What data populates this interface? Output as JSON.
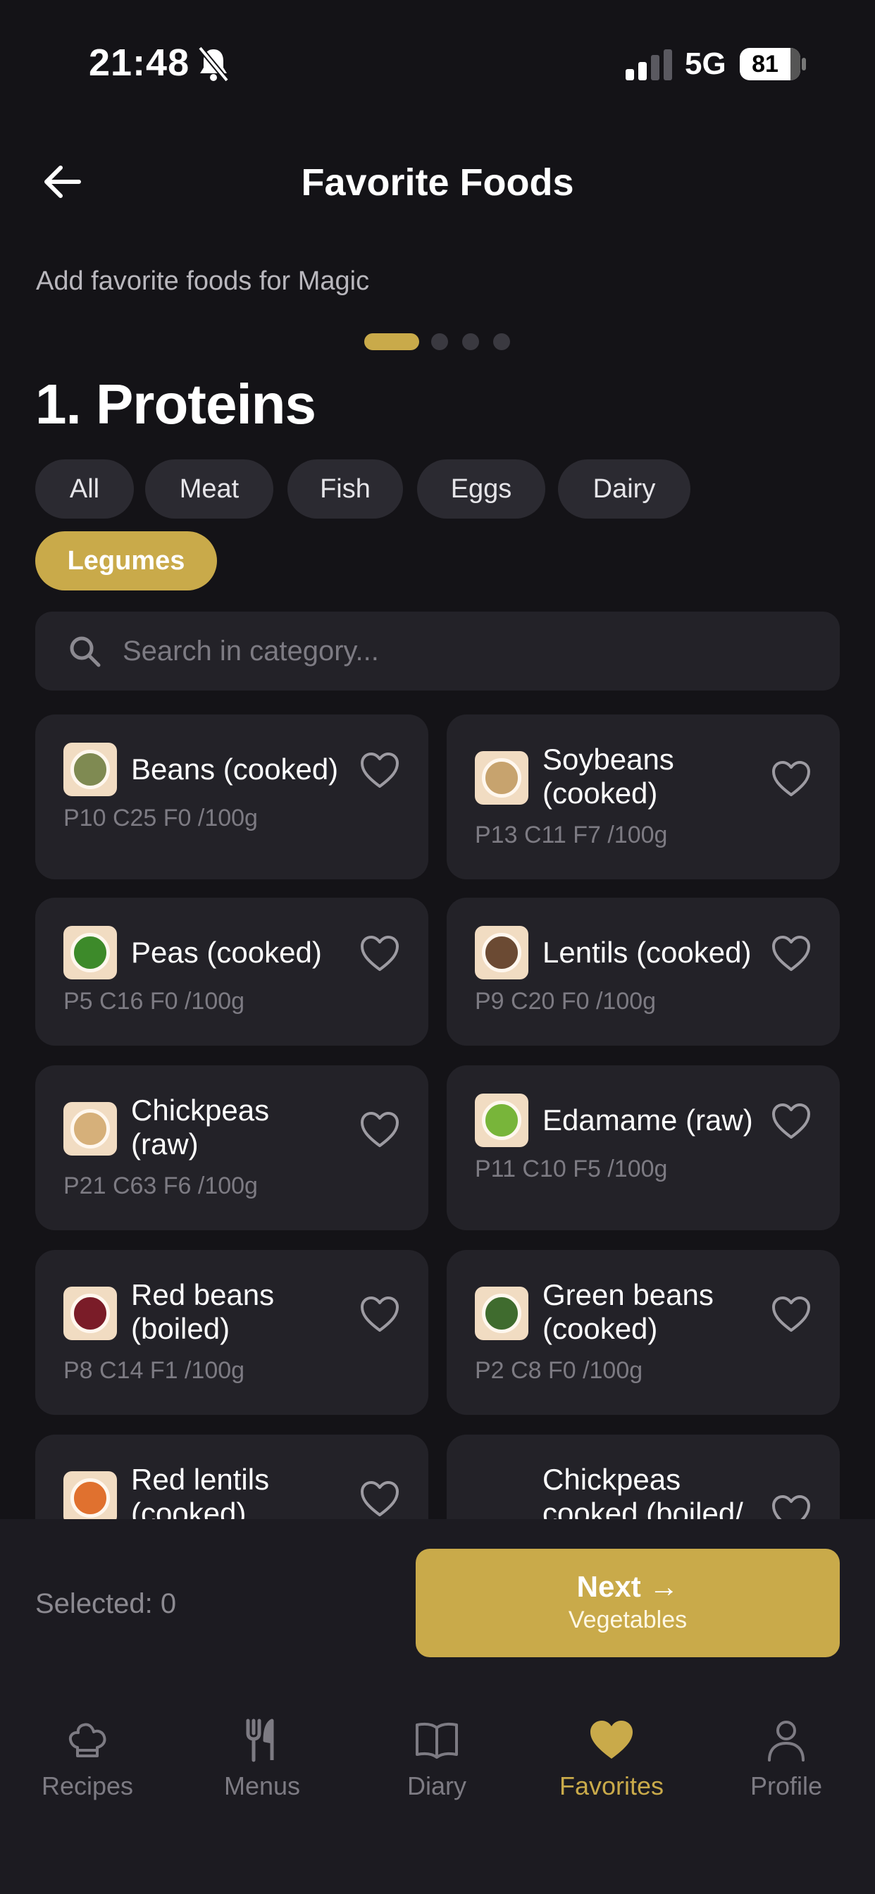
{
  "status": {
    "time": "21:48",
    "network": "5G",
    "battery": "81"
  },
  "header": {
    "title": "Favorite Foods",
    "subtitle": "Add favorite foods for Magic"
  },
  "pager": {
    "total": 4,
    "active": 1
  },
  "section": {
    "title": "1. Proteins"
  },
  "chips": [
    {
      "label": "All",
      "active": false
    },
    {
      "label": "Meat",
      "active": false
    },
    {
      "label": "Fish",
      "active": false
    },
    {
      "label": "Eggs",
      "active": false
    },
    {
      "label": "Dairy",
      "active": false
    },
    {
      "label": "Legumes",
      "active": true
    }
  ],
  "search": {
    "placeholder": "Search in category..."
  },
  "foods": [
    {
      "name": "Beans (cooked)",
      "macros": "P10 C25 F0 /100g",
      "thumb": "#7f8a52",
      "thumb_icon": "beans-bowl-icon"
    },
    {
      "name": "Soybeans (cooked)",
      "macros": "P13 C11 F7 /100g",
      "thumb": "#c7a36e",
      "thumb_icon": "soybeans-bowl-icon"
    },
    {
      "name": "Peas (cooked)",
      "macros": "P5 C16 F0 /100g",
      "thumb": "#3d8a2a",
      "thumb_icon": "peas-bowl-icon"
    },
    {
      "name": "Lentils (cooked)",
      "macros": "P9 C20 F0 /100g",
      "thumb": "#6b4a33",
      "thumb_icon": "lentils-bowl-icon"
    },
    {
      "name": "Chickpeas (raw)",
      "macros": "P21 C63 F6 /100g",
      "thumb": "#d6b07a",
      "thumb_icon": "chickpeas-bowl-icon"
    },
    {
      "name": "Edamame (raw)",
      "macros": "P11 C10 F5 /100g",
      "thumb": "#78b53a",
      "thumb_icon": "edamame-bowl-icon"
    },
    {
      "name": "Red beans (boiled)",
      "macros": "P8 C14 F1 /100g",
      "thumb": "#7a1c28",
      "thumb_icon": "red-beans-bowl-icon"
    },
    {
      "name": "Green beans (cooked)",
      "macros": "P2 C8 F0 /100g",
      "thumb": "#3f6b2e",
      "thumb_icon": "green-beans-bowl-icon"
    },
    {
      "name": "Red lentils (cooked)",
      "macros": "",
      "thumb": "#e0712f",
      "thumb_icon": "red-lentils-bowl-icon"
    },
    {
      "name": "Chickpeas cooked (boiled/",
      "macros": "",
      "thumb": "",
      "thumb_icon": ""
    }
  ],
  "footer": {
    "selected": "Selected: 0",
    "next_label": "Next →",
    "next_sub": "Vegetables"
  },
  "tabs": [
    {
      "label": "Recipes",
      "icon": "chef-hat-icon",
      "active": false
    },
    {
      "label": "Menus",
      "icon": "fork-knife-icon",
      "active": false
    },
    {
      "label": "Diary",
      "icon": "book-icon",
      "active": false
    },
    {
      "label": "Favorites",
      "icon": "heart-icon",
      "active": true
    },
    {
      "label": "Profile",
      "icon": "person-icon",
      "active": false
    }
  ],
  "colors": {
    "accent": "#c9aa4a",
    "background": "#141317",
    "card": "#232228",
    "chip": "#2b2a31",
    "muted": "#7d7b83"
  }
}
